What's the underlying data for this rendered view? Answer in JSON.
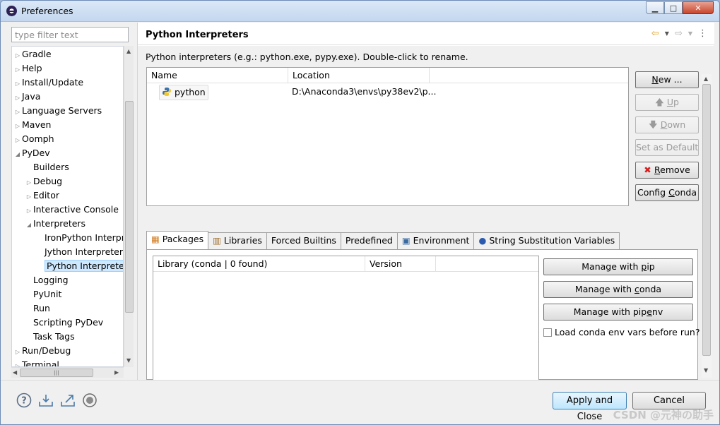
{
  "window": {
    "title": "Preferences",
    "minimize": "▁",
    "maximize": "□",
    "close": "✕"
  },
  "left": {
    "filter_placeholder": "type filter text",
    "tree": [
      {
        "label": "Gradle",
        "level": 0,
        "expander": "▷"
      },
      {
        "label": "Help",
        "level": 0,
        "expander": "▷"
      },
      {
        "label": "Install/Update",
        "level": 0,
        "expander": "▷"
      },
      {
        "label": "Java",
        "level": 0,
        "expander": "▷"
      },
      {
        "label": "Language Servers",
        "level": 0,
        "expander": "▷"
      },
      {
        "label": "Maven",
        "level": 0,
        "expander": "▷"
      },
      {
        "label": "Oomph",
        "level": 0,
        "expander": "▷"
      },
      {
        "label": "PyDev",
        "level": 0,
        "expander": "◢"
      },
      {
        "label": "Builders",
        "level": 1,
        "expander": ""
      },
      {
        "label": "Debug",
        "level": 1,
        "expander": "▷"
      },
      {
        "label": "Editor",
        "level": 1,
        "expander": "▷"
      },
      {
        "label": "Interactive Console",
        "level": 1,
        "expander": "▷"
      },
      {
        "label": "Interpreters",
        "level": 1,
        "expander": "◢"
      },
      {
        "label": "IronPython Interpreter",
        "level": 2,
        "expander": ""
      },
      {
        "label": "Jython Interpreter",
        "level": 2,
        "expander": ""
      },
      {
        "label": "Python Interpreter",
        "level": 2,
        "expander": "",
        "selected": true
      },
      {
        "label": "Logging",
        "level": 1,
        "expander": ""
      },
      {
        "label": "PyUnit",
        "level": 1,
        "expander": ""
      },
      {
        "label": "Run",
        "level": 1,
        "expander": ""
      },
      {
        "label": "Scripting PyDev",
        "level": 1,
        "expander": ""
      },
      {
        "label": "Task Tags",
        "level": 1,
        "expander": ""
      },
      {
        "label": "Run/Debug",
        "level": 0,
        "expander": "▷"
      },
      {
        "label": "Terminal",
        "level": 0,
        "expander": "▷"
      }
    ]
  },
  "page": {
    "title": "Python Interpreters",
    "description": "Python interpreters (e.g.: python.exe, pypy.exe).   Double-click to rename.",
    "columns": [
      "Name",
      "Location"
    ],
    "interpreters": [
      {
        "name": "python",
        "location": "D:\\Anaconda3\\envs\\py38ev2\\p..."
      }
    ],
    "buttons": {
      "new": {
        "pre": "",
        "u": "N",
        "post": "ew ..."
      },
      "up": {
        "pre": "",
        "u": "U",
        "post": "p"
      },
      "down": {
        "pre": "",
        "u": "D",
        "post": "own"
      },
      "set_default": "Set as Default",
      "remove": {
        "pre": "",
        "u": "R",
        "post": "emove"
      },
      "config_conda": {
        "pre": "Config ",
        "u": "C",
        "post": "onda"
      }
    },
    "tabs": [
      "Packages",
      "Libraries",
      "Forced Builtins",
      "Predefined",
      "Environment",
      "String Substitution Variables"
    ],
    "packages": {
      "columns": [
        "Library (conda | 0 found)",
        "Version"
      ],
      "buttons": {
        "pip": {
          "pre": "Manage with ",
          "u": "p",
          "post": "ip"
        },
        "conda": {
          "pre": "Manage with ",
          "u": "c",
          "post": "onda"
        },
        "pipenv": {
          "pre": "Manage with pip",
          "u": "e",
          "post": "nv"
        }
      },
      "checkbox_label": "Load conda env vars before run?"
    }
  },
  "footer": {
    "apply_close": "Apply and Close",
    "cancel": "Cancel"
  },
  "watermark": "CSDN @元神の助手",
  "colors": {
    "selection": "#cde8ff",
    "window_border": "#6d8bb5",
    "close_button": "#c8452c"
  }
}
